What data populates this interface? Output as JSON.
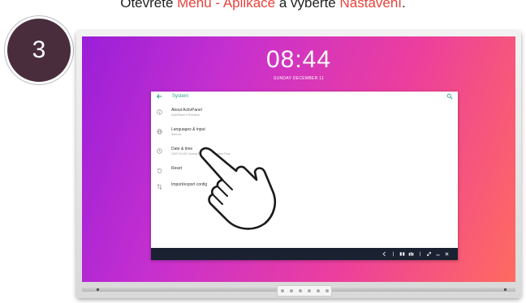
{
  "instruction": {
    "prefix": "Otevřete ",
    "menu": "Menu",
    "arrow": " - ",
    "apps": "Aplikace",
    "middle": " a vyberte ",
    "settings": "Nastavení",
    "suffix": "."
  },
  "step": "3",
  "lockscreen": {
    "time": "08:44",
    "date": "SUNDAY DECEMBER 11"
  },
  "settings_window": {
    "title": "System",
    "items": [
      {
        "label": "About ActivPanel",
        "sub": "ActivPanel 9 Premium",
        "icon": "info-icon"
      },
      {
        "label": "Languages & input",
        "sub": "Sleuxrd",
        "icon": "globe-icon"
      },
      {
        "label": "Date & time",
        "sub": "GMT+01:00 Central European Standard Time",
        "icon": "clock-icon"
      },
      {
        "label": "Reset",
        "sub": "",
        "icon": "reset-icon"
      },
      {
        "label": "Import/export config",
        "sub": "",
        "icon": "import-export-icon"
      }
    ]
  },
  "colors": {
    "accent": "#2a9d8f",
    "highlight": "#e8423b",
    "badge": "#4a2d3d",
    "taskbar": "#1a2231"
  }
}
